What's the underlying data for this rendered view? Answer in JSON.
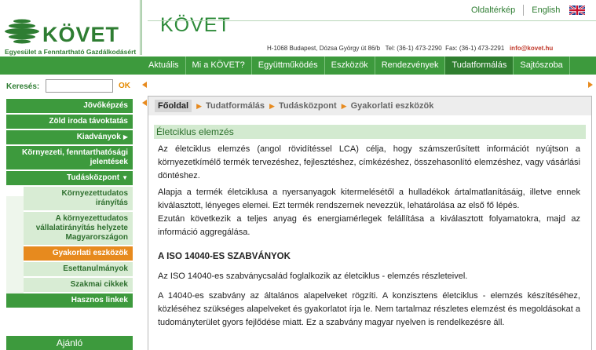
{
  "header": {
    "logo_text": "KÖVET",
    "logo_subtitle": "Egyesület a Fenntartható Gazdálkodásért",
    "site_title": "KÖVET",
    "top_links": [
      "Oldaltérkép",
      "English"
    ],
    "address": "H-1068 Budapest, Dózsa György út 86/b",
    "phone": "Tel: (36-1) 473-2290",
    "fax": "Fax: (36-1) 473-2291",
    "email": "info@kovet.hu"
  },
  "nav": {
    "items": [
      "Aktuális",
      "Mi a KÖVET?",
      "Együttműködés",
      "Eszközök",
      "Rendezvények",
      "Tudatformálás",
      "Sajtószoba"
    ],
    "active": "Tudatformálás"
  },
  "search": {
    "label": "Keresés:",
    "value": "",
    "ok_label": "OK"
  },
  "sidebar": {
    "items": [
      {
        "label": "Jövőképzés",
        "kind": "main"
      },
      {
        "label": "Zöld iroda távoktatás",
        "kind": "main"
      },
      {
        "label": "Kiadványok",
        "kind": "main",
        "arrow": "▶"
      },
      {
        "label": "Környezeti, fenntarthatósági jelentések",
        "kind": "main"
      },
      {
        "label": "Tudásközpont",
        "kind": "main",
        "arrow": "▼"
      },
      {
        "label": "Környezettudatos irányítás",
        "kind": "sub"
      },
      {
        "label": "A környezettudatos vállalatirányítás helyzete Magyarországon",
        "kind": "sub"
      },
      {
        "label": "Gyakorlati eszközök",
        "kind": "current"
      },
      {
        "label": "Esettanulmányok",
        "kind": "sub"
      },
      {
        "label": "Szakmai cikkek",
        "kind": "sub"
      },
      {
        "label": "Hasznos linkek",
        "kind": "main"
      }
    ],
    "footer_label": "Ajánló"
  },
  "breadcrumb": [
    "Főoldal",
    "Tudatformálás",
    "Tudásközpont",
    "Gyakorlati eszközök"
  ],
  "content": {
    "section_title": "Életciklus elemzés",
    "p1": "Az életciklus elemzés (angol rövidítéssel LCA) célja, hogy számszerűsített információt nyújtson a környezetkímélő termék tervezéshez, fejlesztéshez, címkézéshez, összehasonlító elemzéshez, vagy vásárlási döntéshez.",
    "p2": "Alapja a termék életciklusa a nyersanyagok kitermelésétől a hulladékok ártalmatlanításáig, illetve ennek kiválasztott, lényeges elemei. Ezt termék rendszernek nevezzük, lehatárolása az első fő lépés.",
    "p3": "Ezután következik a teljes anyag és energiamérlegek felállítása a kiválasztott folyamatokra, majd az információ aggregálása.",
    "iso_heading": "A ISO 14040-ES SZABVÁNYOK",
    "p4": "Az ISO 14040-es szabványcsalád foglalkozik az életciklus - elemzés részleteivel.",
    "p5": "A 14040-es szabvány az általános alapelveket rögzíti. A konzisztens életciklus - elemzés készítéséhez, közléséhez szükséges alapelveket és gyakorlatot írja le. Nem tartalmaz részletes elemzést és megoldásokat a tudományterület gyors fejlődése miatt. Ez a szabvány magyar nyelven is rendelkezésre áll."
  },
  "colors": {
    "brand_green": "#3d9a3d",
    "accent_orange": "#e78a1e",
    "light_green": "#d8ecd4"
  }
}
